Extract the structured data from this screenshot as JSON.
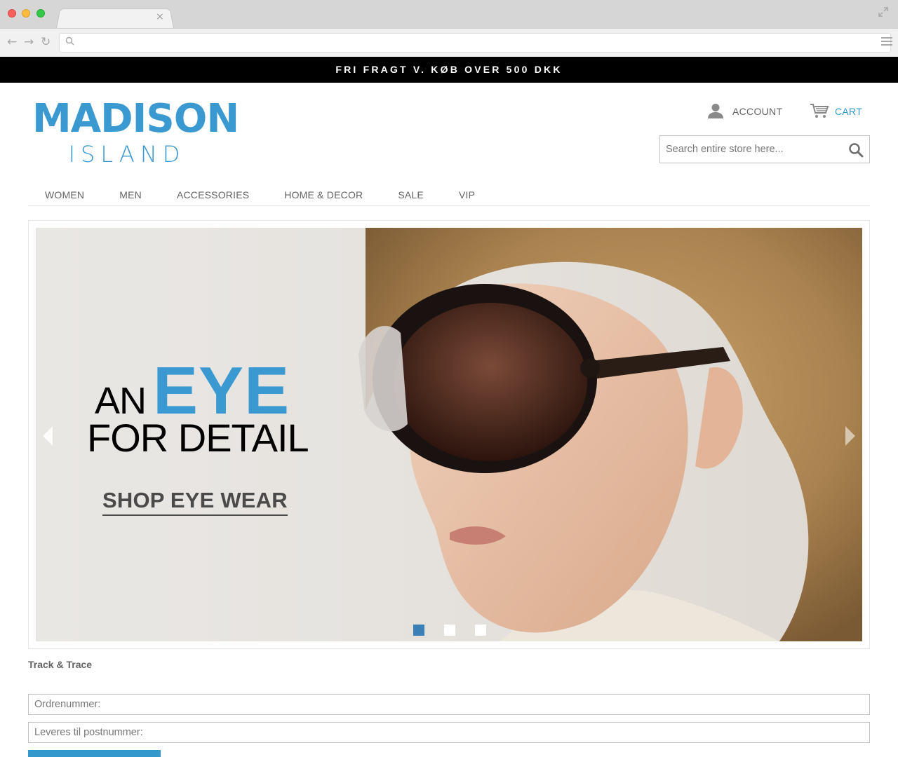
{
  "browser": {
    "tab_close": "×",
    "back": "←",
    "forward": "→",
    "reload": "↻"
  },
  "promo": {
    "text": "FRI FRAGT V. KØB OVER 500 DKK"
  },
  "logo": {
    "main": "MADISON",
    "sub": "ISLAND"
  },
  "header": {
    "account_label": "ACCOUNT",
    "cart_label": "CART",
    "search_placeholder": "Search entire store here..."
  },
  "nav": {
    "items": [
      {
        "label": "WOMEN"
      },
      {
        "label": "MEN"
      },
      {
        "label": "ACCESSORIES"
      },
      {
        "label": "HOME & DECOR"
      },
      {
        "label": "SALE"
      },
      {
        "label": "VIP"
      }
    ]
  },
  "slide": {
    "line1_small": "AN",
    "line1_big": "EYE",
    "line2": "FOR DETAIL",
    "cta": "SHOP EYE WEAR",
    "pager_active": 1,
    "pager_count": 3
  },
  "track": {
    "title": "Track & Trace",
    "order_placeholder": "Ordrenummer:",
    "zip_placeholder": "Leveres til postnummer:"
  },
  "colors": {
    "brand": "#3a99d0",
    "pager_active": "#3a7fb5",
    "promo_bg": "#000000"
  }
}
